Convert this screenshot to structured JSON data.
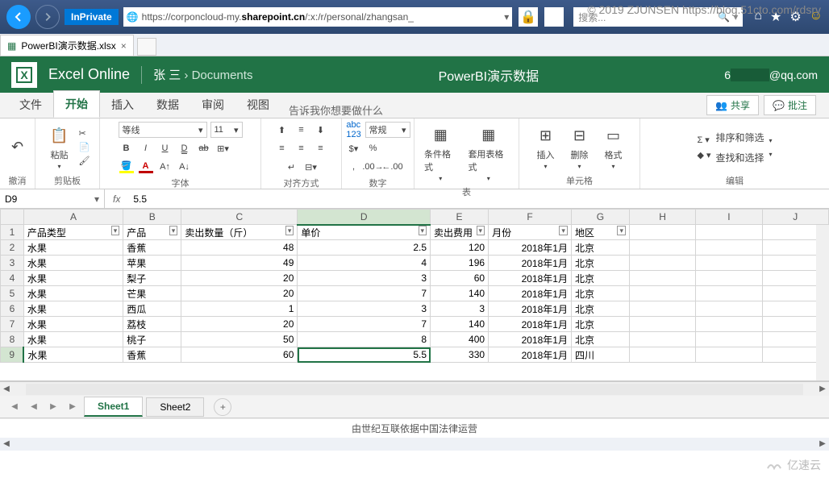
{
  "watermark": "© 2019 ZJUNSEN https://blog.51cto.com/rdsrv",
  "bottom_brand": "亿速云",
  "browser": {
    "inprivate": "InPrivate",
    "url_prefix": "https://corponcloud-my.",
    "url_bold": "sharepoint.cn",
    "url_suffix": "/:x:/r/personal/zhangsan_",
    "search_placeholder": "搜索..."
  },
  "tab": {
    "title": "PowerBI演示数据.xlsx"
  },
  "header": {
    "product": "Excel Online",
    "user_name": "张 三",
    "crumb_sep": "›",
    "crumb_folder": "Documents",
    "doc_title": "PowerBI演示数据",
    "account_prefix": "6",
    "account_mask": "5",
    "account_suffix": "@qq.com"
  },
  "ribbon_tabs": {
    "file": "文件",
    "home": "开始",
    "insert": "插入",
    "data": "数据",
    "review": "审阅",
    "view": "视图",
    "tell_me": "告诉我你想要做什么",
    "share": "共享",
    "comment": "批注"
  },
  "ribbon": {
    "undo": "撤消",
    "paste": "粘贴",
    "clipboard": "剪贴板",
    "font_name": "等线",
    "font_size": "11",
    "font_group": "字体",
    "align_group": "对齐方式",
    "number_format": "常规",
    "number_group": "数字",
    "cond_fmt": "条件格式",
    "table_fmt": "套用表格式",
    "table_group": "表",
    "insert": "插入",
    "delete": "删除",
    "format": "格式",
    "cells_group": "单元格",
    "sort_filter": "排序和筛选",
    "find_select": "查找和选择",
    "edit_group": "编辑"
  },
  "formula_bar": {
    "cell_ref": "D9",
    "fx": "fx",
    "value": "5.5"
  },
  "columns": [
    "A",
    "B",
    "C",
    "D",
    "E",
    "F",
    "G",
    "H",
    "I",
    "J"
  ],
  "headers": {
    "c1": "产品类型",
    "c2": "产品",
    "c3": "卖出数量（斤）",
    "c4": "单价",
    "c5": "卖出费用",
    "c6": "月份",
    "c7": "地区"
  },
  "rows": [
    {
      "n": "2",
      "a": "水果",
      "b": "香蕉",
      "c": "48",
      "d": "2.5",
      "e": "120",
      "f": "2018年1月",
      "g": "北京"
    },
    {
      "n": "3",
      "a": "水果",
      "b": "苹果",
      "c": "49",
      "d": "4",
      "e": "196",
      "f": "2018年1月",
      "g": "北京"
    },
    {
      "n": "4",
      "a": "水果",
      "b": "梨子",
      "c": "20",
      "d": "3",
      "e": "60",
      "f": "2018年1月",
      "g": "北京"
    },
    {
      "n": "5",
      "a": "水果",
      "b": "芒果",
      "c": "20",
      "d": "7",
      "e": "140",
      "f": "2018年1月",
      "g": "北京"
    },
    {
      "n": "6",
      "a": "水果",
      "b": "西瓜",
      "c": "1",
      "d": "3",
      "e": "3",
      "f": "2018年1月",
      "g": "北京"
    },
    {
      "n": "7",
      "a": "水果",
      "b": "荔枝",
      "c": "20",
      "d": "7",
      "e": "140",
      "f": "2018年1月",
      "g": "北京"
    },
    {
      "n": "8",
      "a": "水果",
      "b": "桃子",
      "c": "50",
      "d": "8",
      "e": "400",
      "f": "2018年1月",
      "g": "北京"
    },
    {
      "n": "9",
      "a": "水果",
      "b": "香蕉",
      "c": "60",
      "d": "5.5",
      "e": "330",
      "f": "2018年1月",
      "g": "四川"
    }
  ],
  "sheets": {
    "s1": "Sheet1",
    "s2": "Sheet2"
  },
  "footer": "由世纪互联依据中国法律运营"
}
